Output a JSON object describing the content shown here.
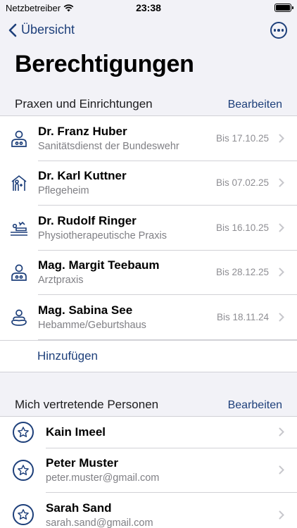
{
  "status_bar": {
    "carrier": "Netzbetreiber",
    "time": "23:38"
  },
  "nav": {
    "back_label": "Übersicht"
  },
  "page_title": "Berechtigungen",
  "practices": {
    "header": "Praxen und Einrichtungen",
    "edit_label": "Bearbeiten",
    "items": [
      {
        "name": "Dr. Franz Huber",
        "subtitle": "Sanitätsdienst der Bundeswehr",
        "date": "Bis 17.10.25",
        "icon": "doctor-icon"
      },
      {
        "name": "Dr. Karl Kuttner",
        "subtitle": "Pflegeheim",
        "date": "Bis 07.02.25",
        "icon": "care-home-icon"
      },
      {
        "name": "Dr. Rudolf Ringer",
        "subtitle": "Physiotherapeutische Praxis",
        "date": "Bis 16.10.25",
        "icon": "physiotherapy-icon"
      },
      {
        "name": "Mag. Margit Teebaum",
        "subtitle": "Arztpraxis",
        "date": "Bis 28.12.25",
        "icon": "doctor-icon"
      },
      {
        "name": "Mag. Sabina See",
        "subtitle": "Hebamme/Geburtshaus",
        "date": "Bis 18.11.24",
        "icon": "midwife-icon"
      }
    ],
    "add_label": "Hinzufügen"
  },
  "representatives": {
    "header": "Mich vertretende Personen",
    "edit_label": "Bearbeiten",
    "items": [
      {
        "name": "Kain Imeel",
        "email": "",
        "icon": "star-icon"
      },
      {
        "name": "Peter Muster",
        "email": "peter.muster@gmail.com",
        "icon": "star-icon"
      },
      {
        "name": "Sarah Sand",
        "email": "sarah.sand@gmail.com",
        "icon": "star-icon"
      }
    ]
  },
  "colors": {
    "accent": "#1d3f7a",
    "background": "#f2f2f7",
    "secondary_text": "#7f7f84"
  }
}
